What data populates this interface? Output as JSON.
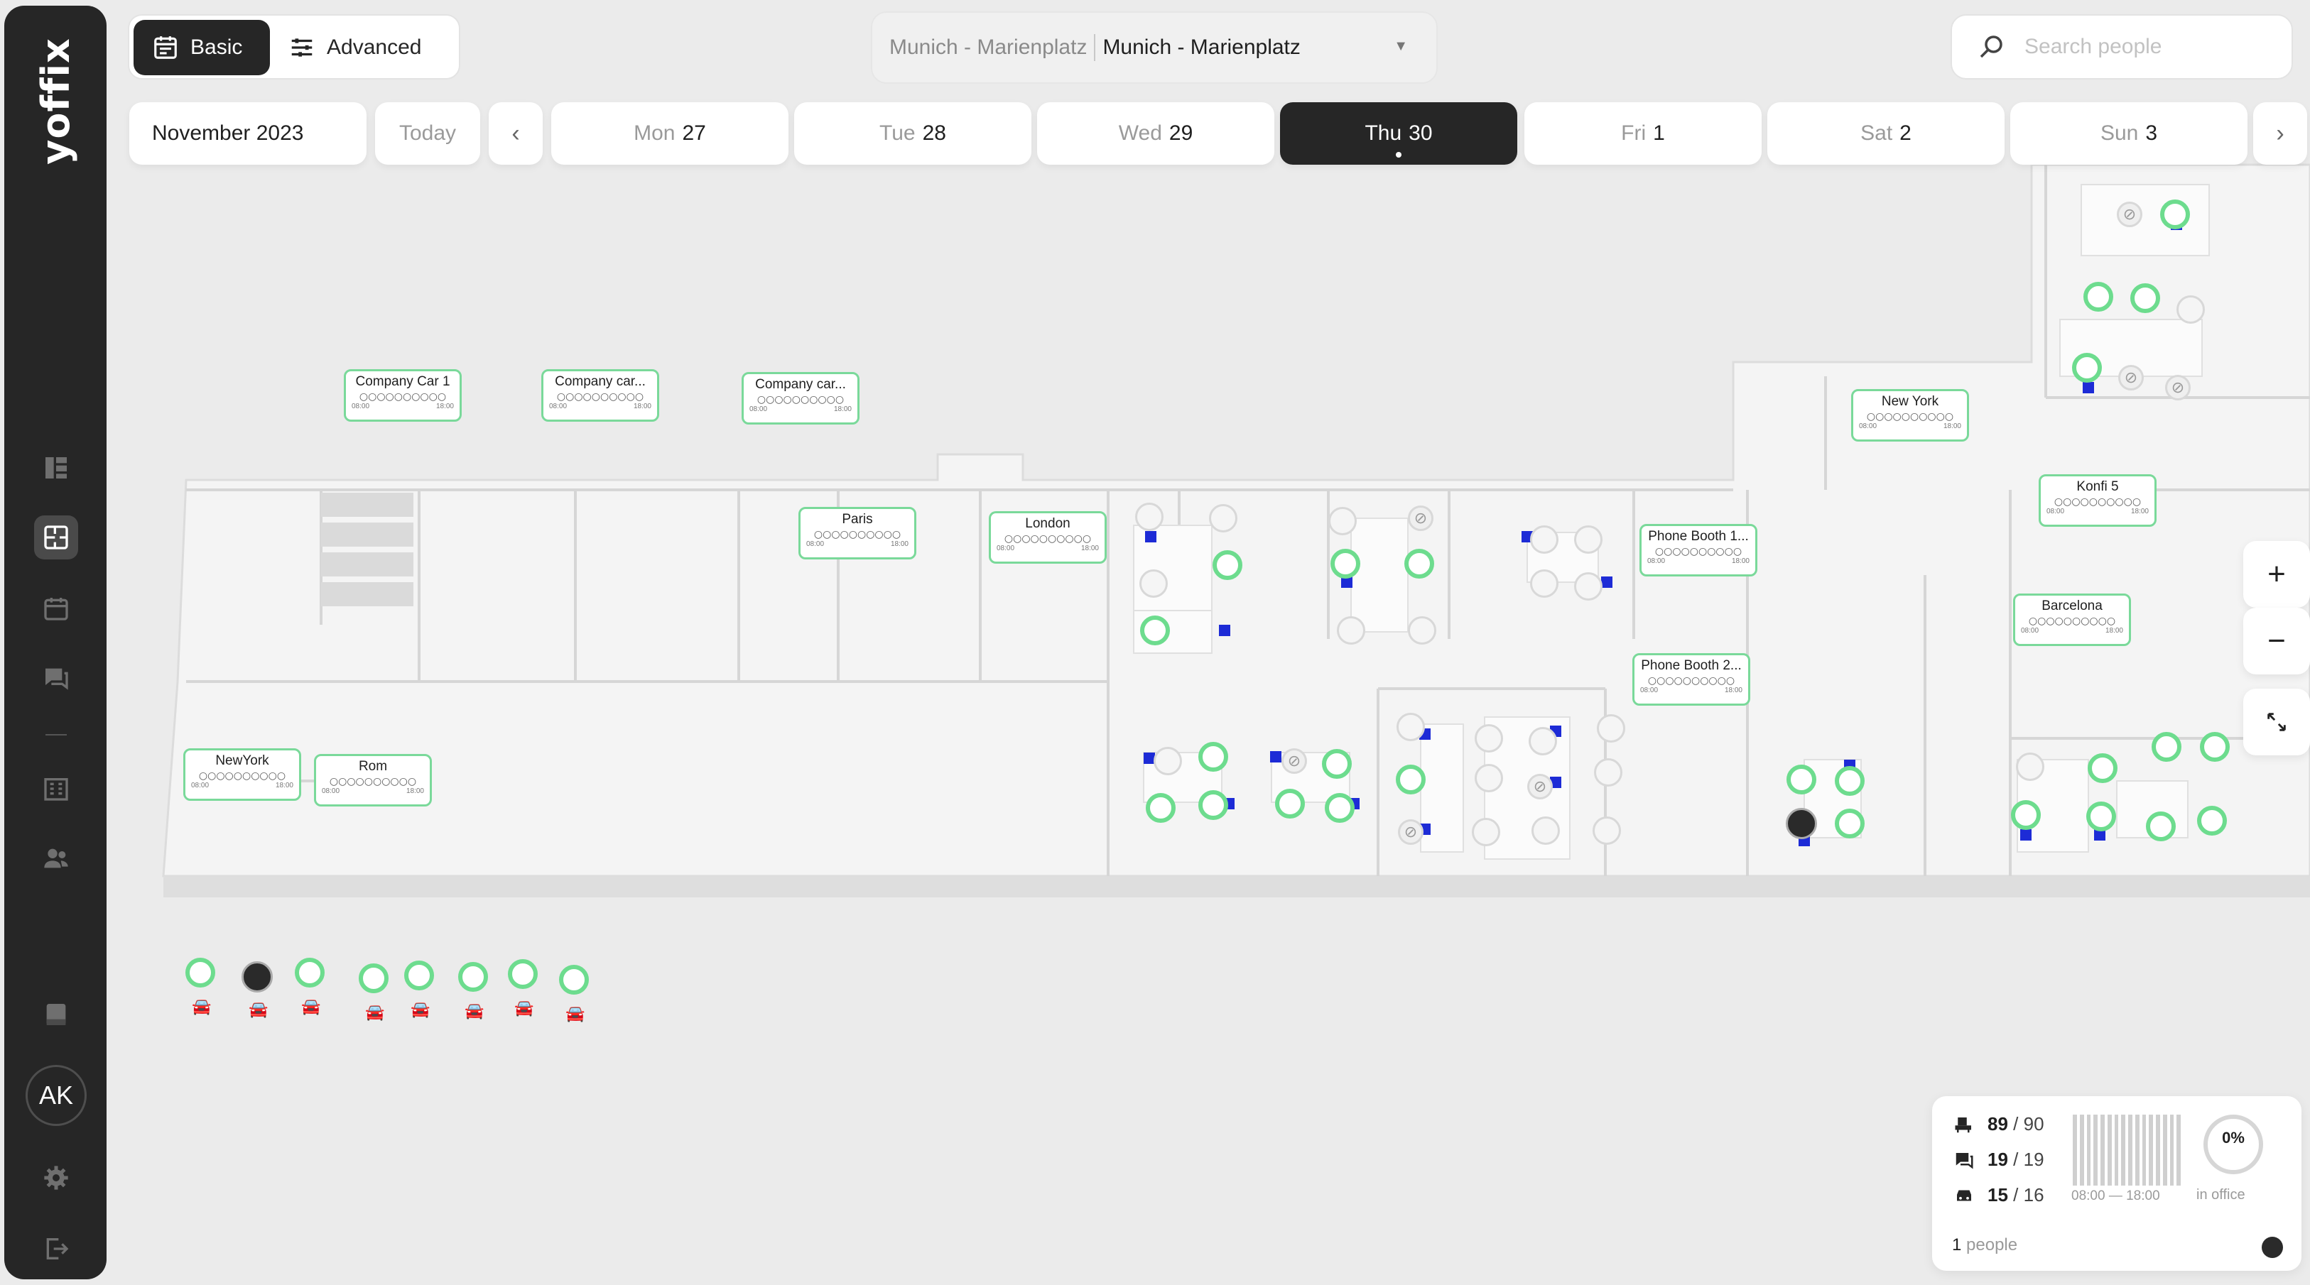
{
  "app": {
    "logo": "yoffix"
  },
  "modes": {
    "basic_label": "Basic",
    "advanced_label": "Advanced",
    "active": "Basic"
  },
  "location": {
    "building": "Munich - Marienplatz",
    "floor": "Munich - Marienplatz"
  },
  "search": {
    "placeholder": "Search people"
  },
  "calendar": {
    "month": "November 2023",
    "today_label": "Today",
    "prev_icon": "chevron-left-icon",
    "next_icon": "chevron-right-icon",
    "days": [
      {
        "name": "Mon",
        "date": "27"
      },
      {
        "name": "Tue",
        "date": "28"
      },
      {
        "name": "Wed",
        "date": "29"
      },
      {
        "name": "Thu",
        "date": "30"
      },
      {
        "name": "Fri",
        "date": "1"
      },
      {
        "name": "Sat",
        "date": "2"
      },
      {
        "name": "Sun",
        "date": "3"
      }
    ],
    "selected": "Thu 30"
  },
  "sidebar": {
    "icons": [
      "dashboard-icon",
      "floorplan-icon",
      "calendar-icon",
      "chat-icon",
      "building-icon",
      "users-icon",
      "notes-icon",
      "settings-icon",
      "logout-icon"
    ],
    "active": "floorplan-icon",
    "avatar": "AK"
  },
  "rooms": [
    {
      "name": "Company Car 1",
      "start": "08:00",
      "end": "18:00",
      "dots": "○○○○○○○○○○"
    },
    {
      "name": "Company car...",
      "start": "08:00",
      "end": "18:00",
      "dots": "○○○○○○○○○○"
    },
    {
      "name": "Company car...",
      "start": "08:00",
      "end": "18:00",
      "dots": "○○○○○○○○○○"
    },
    {
      "name": "Paris",
      "start": "08:00",
      "end": "18:00",
      "dots": "○○○○○○○○○○"
    },
    {
      "name": "London",
      "start": "08:00",
      "end": "18:00",
      "dots": "○○○○○○○○○○"
    },
    {
      "name": "Phone Booth 1...",
      "start": "08:00",
      "end": "18:00",
      "dots": "○○○○○○○○○○"
    },
    {
      "name": "Phone Booth 2...",
      "start": "08:00",
      "end": "18:00",
      "dots": "○○○○○○○○○○"
    },
    {
      "name": "New York",
      "start": "08:00",
      "end": "18:00",
      "dots": "○○○○○○○○○○"
    },
    {
      "name": "Konfi 5",
      "start": "08:00",
      "end": "18:00",
      "dots": "○○○○○○○○○○"
    },
    {
      "name": "Barcelona",
      "start": "08:00",
      "end": "18:00",
      "dots": "○○○○○○○○○○"
    },
    {
      "name": "NewYork",
      "start": "08:00",
      "end": "18:00",
      "dots": "○○○○○○○○○○"
    },
    {
      "name": "Rom",
      "start": "08:00",
      "end": "18:00",
      "dots": "○○○○○○○○○○"
    }
  ],
  "map_controls": {
    "zoom_in": "+",
    "zoom_out": "−",
    "expand_icon": "expand-icon"
  },
  "stats": {
    "desks": {
      "used": "89",
      "total": "90"
    },
    "rooms": {
      "used": "19",
      "total": "19"
    },
    "parking": {
      "used": "15",
      "total": "16"
    },
    "time_start": "08:00",
    "time_end": "18:00",
    "in_office_pct": "0%",
    "in_office_label": "in office",
    "people_count": "1",
    "people_label": "people"
  },
  "colors": {
    "available": "#6ddc8e",
    "chair": "#1d2bd6",
    "dark": "#262626"
  }
}
